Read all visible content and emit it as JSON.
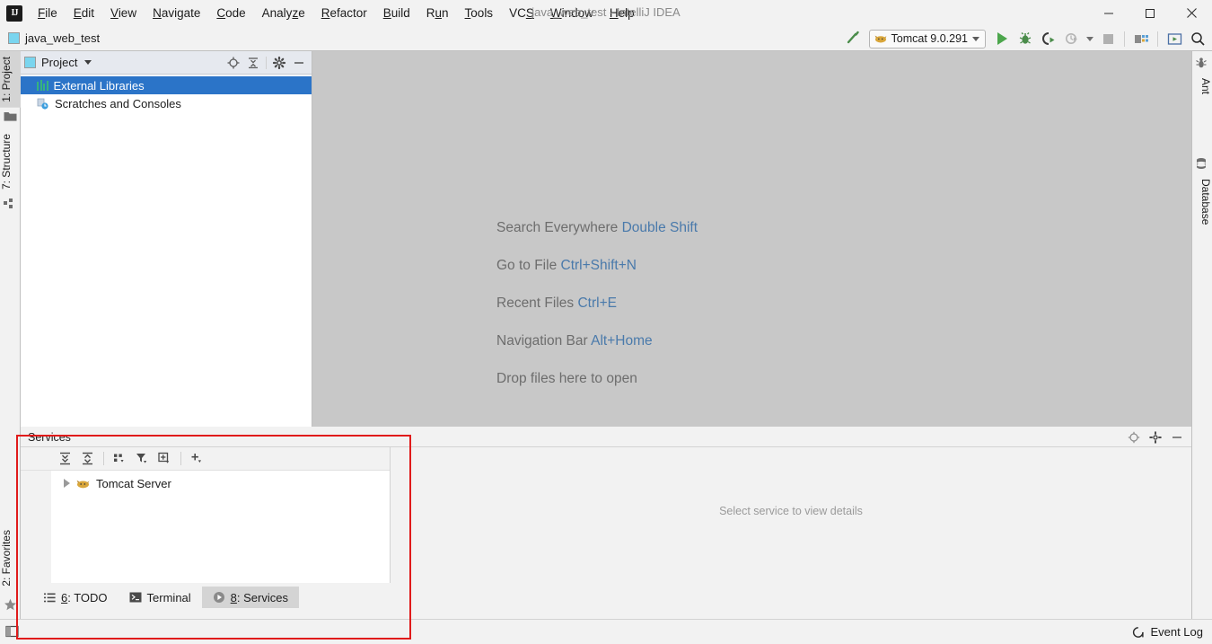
{
  "window": {
    "title": "java_web_test - IntelliJ IDEA",
    "logo_text": "IJ",
    "minimize": "–",
    "maximize": "☐",
    "close": "✕"
  },
  "menu": {
    "items": [
      {
        "label": "File",
        "mnemonic": "F"
      },
      {
        "label": "Edit",
        "mnemonic": "E"
      },
      {
        "label": "View",
        "mnemonic": "V"
      },
      {
        "label": "Navigate",
        "mnemonic": "N"
      },
      {
        "label": "Code",
        "mnemonic": "C"
      },
      {
        "label": "Analyze",
        "mnemonic": "z"
      },
      {
        "label": "Refactor",
        "mnemonic": "R"
      },
      {
        "label": "Build",
        "mnemonic": "B"
      },
      {
        "label": "Run",
        "mnemonic": "u"
      },
      {
        "label": "Tools",
        "mnemonic": "T"
      },
      {
        "label": "VCS",
        "mnemonic": "S"
      },
      {
        "label": "Window",
        "mnemonic": "W"
      },
      {
        "label": "Help",
        "mnemonic": "H"
      }
    ]
  },
  "toolbar": {
    "breadcrumb": "java_web_test",
    "build_icon": "hammer-icon",
    "run_config": {
      "label": "Tomcat 9.0.291",
      "icon": "tomcat-icon",
      "dropdown": "chevron-down-icon"
    },
    "run_icon": "run-icon",
    "debug_icon": "debug-icon",
    "run_coverage_icon": "run-with-coverage-icon",
    "profile_icon": "profile-icon",
    "stop_icon": "stop-icon",
    "project_structure_icon": "project-structure-icon",
    "update_icon": "update-running-application-icon",
    "search_icon": "search-everywhere-icon"
  },
  "left_strip": {
    "tabs": [
      {
        "label": "1: Project",
        "icon": "project-folder-icon",
        "active": true
      },
      {
        "label": "7: Structure",
        "icon": "structure-icon",
        "active": false
      },
      {
        "label": "2: Favorites",
        "icon": "star-icon",
        "active": false
      }
    ]
  },
  "right_strip": {
    "tabs": [
      {
        "label": "Ant",
        "icon": "ant-icon"
      },
      {
        "label": "Database",
        "icon": "database-icon"
      }
    ]
  },
  "project_panel": {
    "title": "Project",
    "icon": "project-icon",
    "caret": "chevron-down-icon",
    "actions": [
      {
        "name": "locate-icon",
        "title": "Select Opened File"
      },
      {
        "name": "collapse-all-icon",
        "title": "Collapse All"
      },
      {
        "name": "gear-icon",
        "title": "Settings"
      },
      {
        "name": "hide-icon",
        "title": "Hide"
      }
    ],
    "tree": [
      {
        "label": "External Libraries",
        "icon": "libraries-icon",
        "selected": true
      },
      {
        "label": "Scratches and Consoles",
        "icon": "scratches-icon",
        "selected": false
      }
    ]
  },
  "editor": {
    "hints": [
      {
        "action": "Search Everywhere",
        "shortcut": "Double Shift"
      },
      {
        "action": "Go to File",
        "shortcut": "Ctrl+Shift+N"
      },
      {
        "action": "Recent Files",
        "shortcut": "Ctrl+E"
      },
      {
        "action": "Navigation Bar",
        "shortcut": "Alt+Home"
      },
      {
        "action": "Drop files here to open",
        "shortcut": ""
      }
    ]
  },
  "services": {
    "title": "Services",
    "header_actions": [
      {
        "name": "locate-icon"
      },
      {
        "name": "gear-icon"
      },
      {
        "name": "hide-icon"
      }
    ],
    "toolbar_actions": [
      {
        "name": "expand-all-icon"
      },
      {
        "name": "collapse-all-icon"
      },
      {
        "name": "group-by-icon"
      },
      {
        "name": "filter-icon"
      },
      {
        "name": "add-view-icon"
      },
      {
        "name": "add-service-icon"
      }
    ],
    "tree": [
      {
        "label": "Tomcat Server",
        "icon": "tomcat-icon",
        "expander": "chevron-right-icon"
      }
    ],
    "detail_placeholder": "Select service to view details"
  },
  "bottom_tabs": [
    {
      "label": "6: TODO",
      "mnemonic": "6",
      "icon": "todo-icon",
      "active": false
    },
    {
      "label": "Terminal",
      "mnemonic": "",
      "icon": "terminal-icon",
      "active": false
    },
    {
      "label": "8: Services",
      "mnemonic": "8",
      "icon": "services-icon",
      "active": true
    }
  ],
  "statusbar": {
    "layout_icon": "toggle-toolwindows-icon",
    "event_log": "Event Log",
    "event_log_icon": "event-log-icon"
  },
  "annotation": {
    "highlight_color": "#e01b1b",
    "target": "services-tool-window"
  },
  "colors": {
    "accent_blue": "#2b74c8",
    "hint_link": "#4a7aab",
    "editor_bg": "#c8c8c8",
    "chrome_bg": "#f2f2f2",
    "panel_bg": "#ffffff"
  }
}
